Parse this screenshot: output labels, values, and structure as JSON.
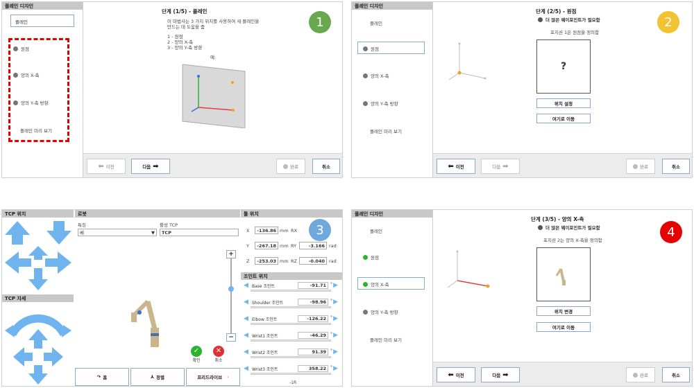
{
  "p1": {
    "header": "플레인 디자인",
    "plane_label": "플레인",
    "items": [
      "원점",
      "양의 X-축",
      "양의 Y-축 방향",
      "플레인 미리 보기"
    ],
    "title": "단계 (1/5) - 플레인",
    "desc1": "이 마법사는 3 가지 위치를 사용하여 새 플레인을",
    "desc2": "만드는 데 도움을 줌",
    "list": [
      "1 - 원점",
      "2 - 양의 X-축",
      "3 - 양의 Y-축 방향"
    ],
    "example": "예:",
    "prev": "이전",
    "next": "다음",
    "finish": "완료",
    "cancel": "취소",
    "badge": "1",
    "badge_color": "#6aa84f"
  },
  "p2": {
    "header": "플레인 디자인",
    "items": [
      "플레인",
      "원점",
      "양의 X-축",
      "양의 Y-축 방향",
      "플레인 미리 보기"
    ],
    "title": "단계 (2/5) - 원점",
    "warn": "더 많은 웨이포인트가 필요함",
    "desc": "포지션 1은 원점을 정의함",
    "qmark": "?",
    "set_pos": "위치 설정",
    "move_here": "여기로 이동",
    "prev": "이전",
    "next": "다음",
    "finish": "완료",
    "cancel": "취소",
    "badge": "2",
    "badge_color": "#f1c232"
  },
  "p3": {
    "tcp_pos": "TCP 위치",
    "tcp_ori": "TCP 자세",
    "robot": "로봇",
    "feature_lbl": "특징",
    "feature_val": "베",
    "active_tcp_lbl": "활성 TCP",
    "active_tcp_val": "TCP",
    "tool_pos": "툴 위치",
    "x": "-136.86",
    "y": "-267.18",
    "z": "-253.03",
    "rx_lbl": "RX",
    "ry_lbl": "RY",
    "rz_lbl": "RZ",
    "ry": "-3.166",
    "rz": "-0.040",
    "mm": "mm",
    "rad": "rad",
    "joint_pos": "조인트 위치",
    "joints": [
      {
        "name": "Base 조인트",
        "val": "-91.71"
      },
      {
        "name": "Shoulder 조인트",
        "val": "-98.96"
      },
      {
        "name": "Elbow 조인트",
        "val": "-126.22"
      },
      {
        "name": "Wrist1 조인트",
        "val": "-46.29"
      },
      {
        "name": "Wrist2 조인트",
        "val": "91.39"
      },
      {
        "name": "Wrist3 조인트",
        "val": "358.22"
      }
    ],
    "deg": "°",
    "foot_note": "-1R",
    "ok": "확인",
    "cancel": "취소",
    "home": "홈",
    "align": "정렬",
    "freedrive": "프리드라이브",
    "badge": "3",
    "badge_color": "#6fa8dc"
  },
  "p4": {
    "header": "플레인 디자인",
    "items": [
      "플레인",
      "원점",
      "양의 X-축",
      "양의 Y-축 방향",
      "플레인 미리 보기"
    ],
    "title": "단계 (3/5) - 양의 X-축",
    "warn": "더 많은 웨이포인트가 필요함",
    "desc": "포지션 2는 양의 X-축을 정의함",
    "change_pos": "위치 변경",
    "move_here": "여기로 이동",
    "prev": "이전",
    "next": "다음",
    "finish": "완료",
    "cancel": "취소",
    "badge": "4",
    "badge_color": "#e60000"
  }
}
